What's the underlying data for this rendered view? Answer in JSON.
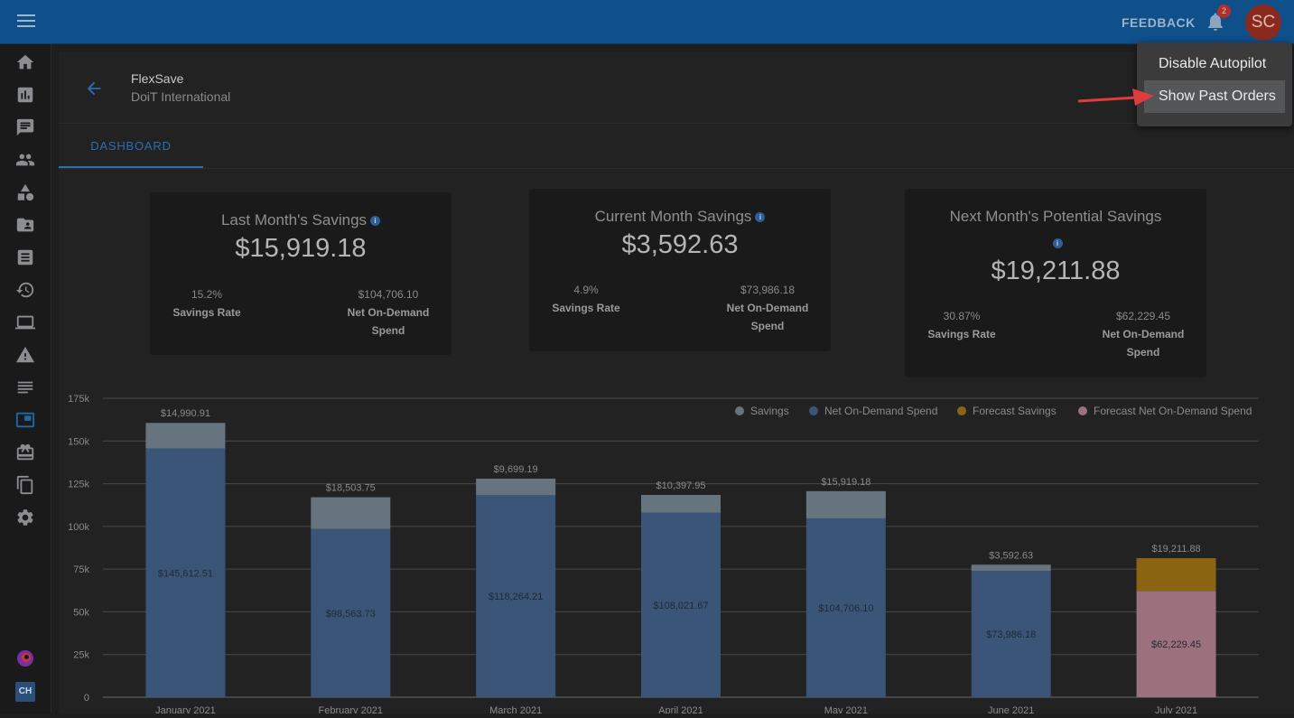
{
  "topbar": {
    "feedback": "FEEDBACK",
    "badge_count": "2",
    "avatar_initials": "SC"
  },
  "sidebar": {
    "items": [
      "home-icon",
      "reports-icon",
      "chat-icon",
      "people-icon",
      "shapes-icon",
      "folder-contact-icon",
      "list-icon",
      "history-icon",
      "laptop-icon",
      "warning-icon",
      "lines-icon",
      "picture-in-picture-icon",
      "gift-icon",
      "copy-icon",
      "gear-icon",
      "org-logo-icon",
      "ch-icon"
    ],
    "active": "picture-in-picture-icon",
    "ch_label": "CH"
  },
  "header": {
    "title": "FlexSave",
    "subtitle": "DoiT International"
  },
  "tabs": [
    {
      "label": "DASHBOARD"
    }
  ],
  "cards": [
    {
      "title": "Last Month's Savings",
      "amount": "$15,919.18",
      "rate_value": "15.2%",
      "rate_label": "Savings Rate",
      "spend_value": "$104,706.10",
      "spend_label": "Net On-Demand Spend"
    },
    {
      "title": "Current Month Savings",
      "amount": "$3,592.63",
      "rate_value": "4.9%",
      "rate_label": "Savings Rate",
      "spend_value": "$73,986.18",
      "spend_label": "Net On-Demand Spend"
    },
    {
      "title": "Next Month's Potential Savings",
      "amount": "$19,211.88",
      "rate_value": "30.87%",
      "rate_label": "Savings Rate",
      "spend_value": "$62,229.45",
      "spend_label": "Net On-Demand Spend"
    }
  ],
  "dropdown": {
    "items": [
      "Disable Autopilot",
      "Show Past Orders"
    ],
    "highlighted": "Show Past Orders"
  },
  "colors": {
    "topbar": "#0f4f8a",
    "savings": "#66747f",
    "net_spend": "#3a5577",
    "forecast_savings": "#8a6410",
    "forecast_net": "#9c707c",
    "accent": "#2a6fb0"
  },
  "chart_data": {
    "type": "bar",
    "stacked": true,
    "categories": [
      "January 2021",
      "February 2021",
      "March 2021",
      "April 2021",
      "May 2021",
      "June 2021",
      "July 2021"
    ],
    "series": [
      {
        "name": "Net On-Demand Spend",
        "values": [
          145612.51,
          98563.73,
          118264.21,
          108021.67,
          104706.1,
          73986.18,
          null
        ]
      },
      {
        "name": "Savings",
        "values": [
          14990.91,
          18503.75,
          9699.19,
          10397.95,
          15919.18,
          3592.63,
          null
        ]
      },
      {
        "name": "Forecast Net On-Demand Spend",
        "values": [
          null,
          null,
          null,
          null,
          null,
          null,
          62229.45
        ]
      },
      {
        "name": "Forecast Savings",
        "values": [
          null,
          null,
          null,
          null,
          null,
          null,
          19211.88
        ]
      }
    ],
    "bar_labels_inside": [
      "$145,612.51",
      "$98,563.73",
      "$118,264.21",
      "$108,021.67",
      "$104,706.10",
      "$73,986.18",
      "$62,229.45"
    ],
    "bar_labels_top": [
      "$14,990.91",
      "$18,503.75",
      "$9,699.19",
      "$10,397.95",
      "$15,919.18",
      "$3,592.63",
      "$19,211.88"
    ],
    "yticks": [
      "0",
      "25k",
      "50k",
      "75k",
      "100k",
      "125k",
      "150k",
      "175k"
    ],
    "ylim": [
      0,
      175000
    ],
    "legend": [
      "Savings",
      "Net On-Demand Spend",
      "Forecast Savings",
      "Forecast Net On-Demand Spend"
    ],
    "legend_position": "top-right",
    "grid": true
  }
}
